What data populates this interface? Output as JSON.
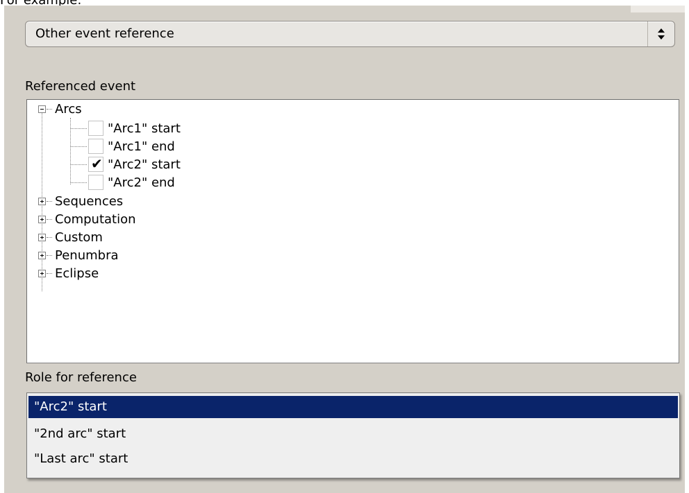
{
  "page": {
    "top_caption": "For example:"
  },
  "event_type_select": {
    "value": "Other event reference"
  },
  "referenced_event": {
    "label": "Referenced event",
    "tree": {
      "arcs": {
        "label": "Arcs",
        "children": [
          {
            "label": "\"Arc1\" start",
            "checked": false
          },
          {
            "label": "\"Arc1\" end",
            "checked": false
          },
          {
            "label": "\"Arc2\" start",
            "checked": true
          },
          {
            "label": "\"Arc2\" end",
            "checked": false
          }
        ]
      },
      "collapsed": [
        "Sequences",
        "Computation",
        "Custom",
        "Penumbra",
        "Eclipse"
      ]
    },
    "checkmark_glyph": "✔"
  },
  "role": {
    "label": "Role for reference",
    "options": [
      "\"Arc2\" start",
      "\"2nd arc\" start",
      "\"Last arc\" start"
    ],
    "selected_index": 0
  },
  "colors": {
    "panel": "#d4d0c8",
    "selection": "#0a246a"
  }
}
